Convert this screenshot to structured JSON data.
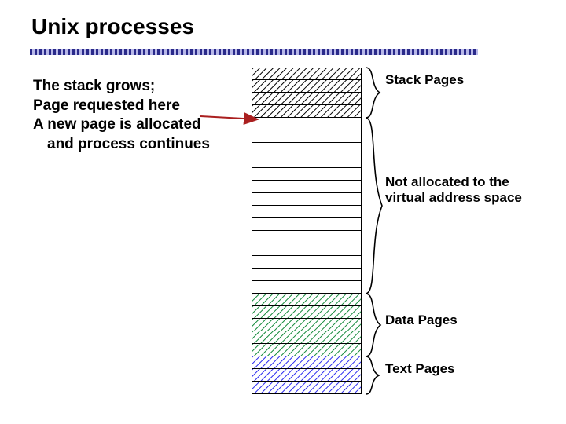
{
  "title": "Unix processes",
  "description": {
    "line1": "The stack grows;",
    "line2": "Page requested here",
    "line3": "A new page is allocated",
    "line4": "and process continues"
  },
  "labels": {
    "stack": "Stack Pages",
    "not_allocated_l1": "Not allocated to the",
    "not_allocated_l2": "virtual address space",
    "data": "Data Pages",
    "text": "Text Pages"
  },
  "memory_rows": [
    {
      "fill": "stack"
    },
    {
      "fill": "stack"
    },
    {
      "fill": "stack"
    },
    {
      "fill": "stack"
    },
    {
      "fill": "empty"
    },
    {
      "fill": "empty"
    },
    {
      "fill": "empty"
    },
    {
      "fill": "empty"
    },
    {
      "fill": "empty"
    },
    {
      "fill": "empty"
    },
    {
      "fill": "empty"
    },
    {
      "fill": "empty"
    },
    {
      "fill": "empty"
    },
    {
      "fill": "empty"
    },
    {
      "fill": "empty"
    },
    {
      "fill": "empty"
    },
    {
      "fill": "empty"
    },
    {
      "fill": "empty"
    },
    {
      "fill": "data"
    },
    {
      "fill": "data"
    },
    {
      "fill": "data"
    },
    {
      "fill": "data"
    },
    {
      "fill": "data"
    },
    {
      "fill": "text"
    },
    {
      "fill": "text"
    },
    {
      "fill": "text"
    }
  ],
  "colors": {
    "stack": "#000000",
    "data": "#138a3a",
    "text": "#2a2af0",
    "divider_dark": "#2a2a8a",
    "divider_light": "#b8b8e8",
    "arrow": "#aa1f1f"
  }
}
